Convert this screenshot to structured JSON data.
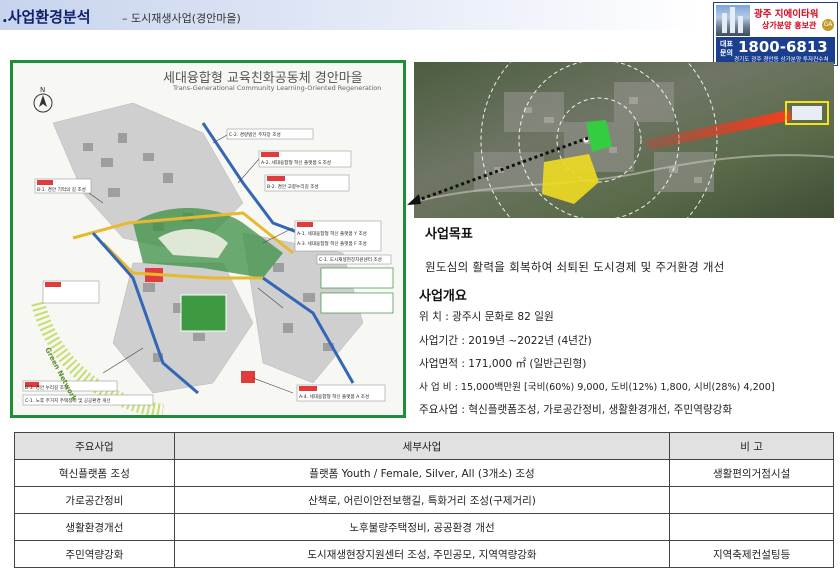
{
  "header": {
    "title": ".사업환경분석",
    "subtitle": "– 도시재생사업(경안마을)"
  },
  "ad": {
    "line1": "광주 지에이타워",
    "line2": "상가분양 홍보관",
    "label": "대표문의",
    "phone": "1800-6813",
    "address": "경기도 광주 경안동 상가분양 투자컨수쳐",
    "badge": "GA"
  },
  "plan": {
    "title": "세대융합형 교육친화공동체 경안마을",
    "subtitle": "Trans-Generational Community Learning-Oriented Regeneration",
    "labels": [
      "C-2. 경량법인 주차장 조성",
      "A-2. 세대융합형 혁신 플랫폼 S 조성",
      "B-2. 경안 고향누리길 조성",
      "B-1. 경안 기억의 길 조성",
      "A-1. 세대융합형 혁신 플랫폼 Y 조성",
      "A-3. 세대융합형 혁신 플랫폼 F 조성",
      "C-1. 도시재생현장지원센터 조성",
      "B-3. 경안 누리길 조성",
      "C-1. 노후 주거지 주택정비 및 공공환경 개선",
      "A-4. 세대융합형 혁신 플랫폼 A 조성",
      "Green Network"
    ]
  },
  "goal": {
    "heading": "사업목표",
    "text": "원도심의 활력을 회복하여 쇠퇴된 도시경제 및 주거환경 개선"
  },
  "overview": {
    "heading": "사업개요",
    "rows": [
      "위    치 : 광주시 문화로 82 일원",
      "사업기간 : 2019년 ~2022년 (4년간)",
      "사업면적 : 171,000 ㎡ (일반근린형)",
      "사 업 비 : 15,000백만원 [국비(60%) 9,000, 도비(12%) 1,800, 시비(28%) 4,200]",
      "주요사업 : 혁신플랫폼조성, 가로공간정비, 생활환경개선, 주민역량강화"
    ]
  },
  "table": {
    "headers": [
      "주요사업",
      "세부사업",
      "비  고"
    ],
    "rows": [
      [
        "혁신플랫폼 조성",
        "플랫폼 Youth / Female, Silver, All (3개소) 조성",
        "생활편의거점시설"
      ],
      [
        "가로공간정비",
        "산책로, 어린이안전보행길, 특화거리 조성(구제거리)",
        ""
      ],
      [
        "생활환경개선",
        "노후불량주택정비, 공공환경 개선",
        ""
      ],
      [
        "주민역량강화",
        "도시재생현장지원센터 조성, 주민공모, 지역역량강화",
        "지역축제컨설팅등"
      ]
    ]
  },
  "colors": {
    "title": "#10206b",
    "frame_green": "#1f8e3a",
    "ad_blue": "#1b3f8e",
    "ad_red": "#d6001c"
  }
}
